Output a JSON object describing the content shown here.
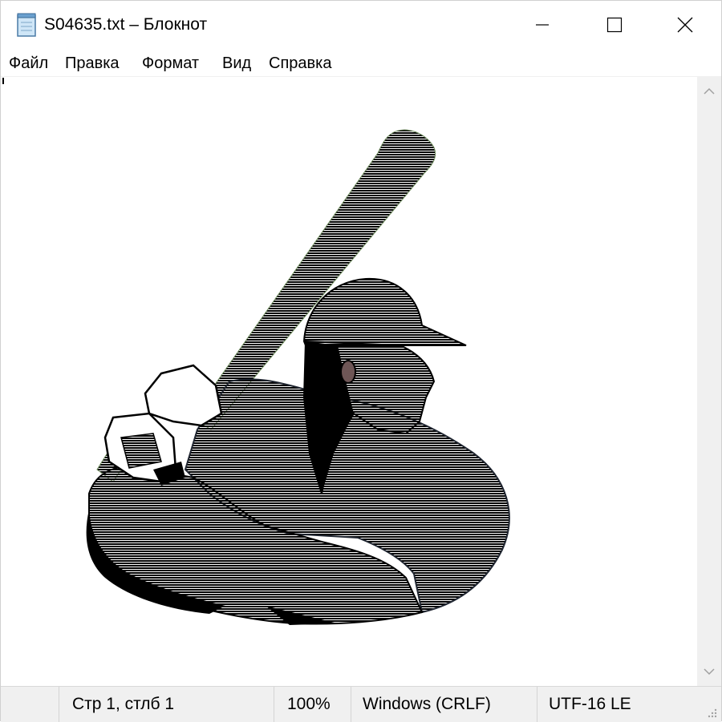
{
  "window": {
    "title": "S04635.txt – Блокнот",
    "app_icon": "notepad-icon"
  },
  "controls": {
    "minimize_icon": "minimize-icon",
    "maximize_icon": "maximize-icon",
    "close_icon": "close-icon"
  },
  "menu": {
    "items": [
      {
        "label": "Файл"
      },
      {
        "label": "Правка"
      },
      {
        "label": "Формат"
      },
      {
        "label": "Вид"
      },
      {
        "label": "Справка"
      }
    ]
  },
  "editor": {
    "content_description_icon": "ascii-art-baseball-batter"
  },
  "scrollbar": {
    "up_icon": "chevron-up-icon",
    "down_icon": "chevron-down-icon"
  },
  "status": {
    "position": "Стр 1, стлб 1",
    "zoom": "100%",
    "line_endings": "Windows (CRLF)",
    "encoding": "UTF-16 LE"
  },
  "colors": {
    "bat": "#9fbf8a",
    "shirt": "#7a93ad",
    "skin": "#6e5656",
    "dark": "#000000",
    "glove": "#ffffff"
  }
}
